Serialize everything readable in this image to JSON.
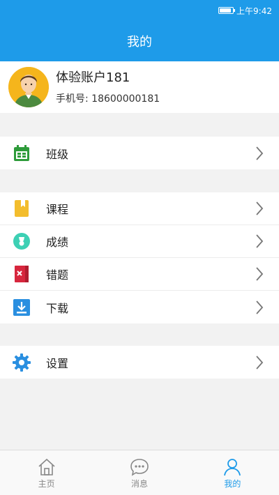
{
  "status": {
    "time": "上午9:42"
  },
  "header": {
    "title": "我的"
  },
  "profile": {
    "name": "体验账户181",
    "phone": "手机号: 18600000181",
    "avatar_icon": "person-avatar"
  },
  "groups": [
    [
      {
        "label": "班级",
        "icon": "class-calendar-icon",
        "color": "#2e9b3a"
      }
    ],
    [
      {
        "label": "课程",
        "icon": "course-book-icon",
        "color": "#f3bd2d"
      },
      {
        "label": "成绩",
        "icon": "grade-medal-icon",
        "color": "#3dd0b4"
      },
      {
        "label": "错题",
        "icon": "wrong-question-icon",
        "color": "#d7263d"
      },
      {
        "label": "下载",
        "icon": "download-icon",
        "color": "#2a8fe0"
      }
    ],
    [
      {
        "label": "设置",
        "icon": "settings-gear-icon",
        "color": "#2a8fe0"
      }
    ]
  ],
  "tabs": [
    {
      "label": "主页",
      "icon": "home-icon"
    },
    {
      "label": "消息",
      "icon": "message-icon"
    },
    {
      "label": "我的",
      "icon": "profile-icon",
      "active": true
    }
  ],
  "colors": {
    "primary": "#1e9be9",
    "background": "#f2f2f2"
  }
}
